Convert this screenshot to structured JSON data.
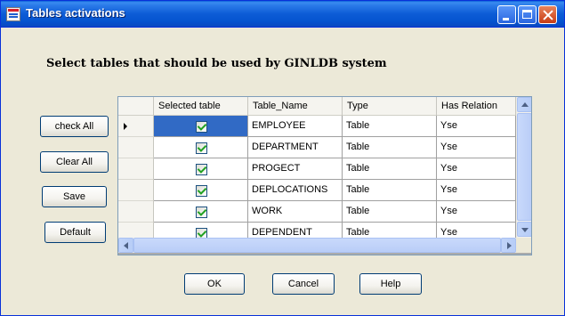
{
  "window": {
    "title": "Tables activations"
  },
  "heading": "Select tables that should be used by GINLDB system",
  "side_buttons": {
    "check_all": "check All",
    "clear_all": "Clear All",
    "save": "Save",
    "default": "Default"
  },
  "grid": {
    "columns": [
      "Selected table",
      "Table_Name",
      "Type",
      "Has Relation"
    ],
    "rows": [
      {
        "selected": true,
        "table_name": "EMPLOYEE",
        "type": "Table",
        "has_relation": "Yse"
      },
      {
        "selected": true,
        "table_name": "DEPARTMENT",
        "type": "Table",
        "has_relation": "Yse"
      },
      {
        "selected": true,
        "table_name": "PROGECT",
        "type": "Table",
        "has_relation": "Yse"
      },
      {
        "selected": true,
        "table_name": "DEPLOCATIONS",
        "type": "Table",
        "has_relation": "Yse"
      },
      {
        "selected": true,
        "table_name": "WORK",
        "type": "Table",
        "has_relation": "Yse"
      },
      {
        "selected": true,
        "table_name": "DEPENDENT",
        "type": "Table",
        "has_relation": "Yse"
      }
    ],
    "current_row": 0,
    "selection_color": "#316ac5"
  },
  "bottom_buttons": {
    "ok": "OK",
    "cancel": "Cancel",
    "help": "Help"
  },
  "colors": {
    "title_bar": "#0553cf",
    "window_face": "#ece9d8",
    "close_button": "#c83c14",
    "checkmark": "#21a121"
  }
}
